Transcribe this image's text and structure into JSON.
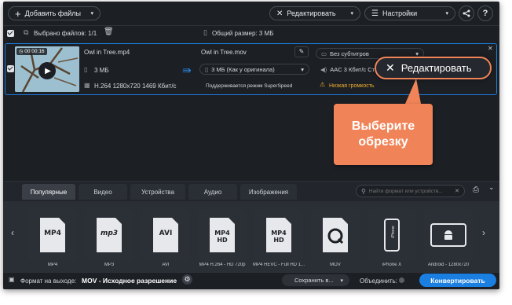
{
  "toolbar": {
    "add_files": "Добавить файлы",
    "edit": "Редактировать",
    "settings": "Настройки"
  },
  "selection_bar": {
    "selected": "Выбрано файлов: 1/1",
    "total_size": "Общий размер: 3 МБ"
  },
  "file": {
    "duration": "00:00:16",
    "name": "Owl in Tree.mp4",
    "size": "3 МБ",
    "codec_info": "H.264 1280x720 1469 Кбит/с",
    "output_name": "Owl in Tree.mov",
    "output_size": "3 МБ (Как у оригинала)",
    "superspeed": "Поддерживается режим SuperSpeed",
    "subtitles": "Без субтитров",
    "audio": "AAC 3 Кбит/с Ст",
    "low_volume": "Низкая громкость",
    "edit_button": "Редактировать"
  },
  "callout": {
    "text_line1": "Выберите",
    "text_line2": "обрезку"
  },
  "tabs": [
    "Популярные",
    "Видео",
    "Устройства",
    "Аудио",
    "Изображения"
  ],
  "search": {
    "placeholder": "Найти формат или устройств..."
  },
  "formats": [
    {
      "label": "MP4",
      "icon": "MP4"
    },
    {
      "label": "MP3",
      "icon": "mp3"
    },
    {
      "label": "AVI",
      "icon": "AVI"
    },
    {
      "label": "MP4 H.264 - HD 720p",
      "icon": "MP4 HD"
    },
    {
      "label": "MP4 HEVC - Full HD 1...",
      "icon": "MP4 HD"
    },
    {
      "label": "MOV",
      "icon": "quicktime-icon"
    },
    {
      "label": "iPhone X",
      "icon": "iphone-icon"
    },
    {
      "label": "Android - 1280x720",
      "icon": "android-icon"
    }
  ],
  "bottom": {
    "output_format_label": "Формат на выходе:",
    "output_format_value": "MOV - Исходное разрешение",
    "save_to": "Сохранить в...",
    "merge": "Объединить:",
    "convert": "Конвертировать"
  },
  "colors": {
    "accent": "#1a7fe0",
    "callout": "#f08458",
    "selection_border": "#1a7fe0",
    "warning": "#f0b030"
  }
}
